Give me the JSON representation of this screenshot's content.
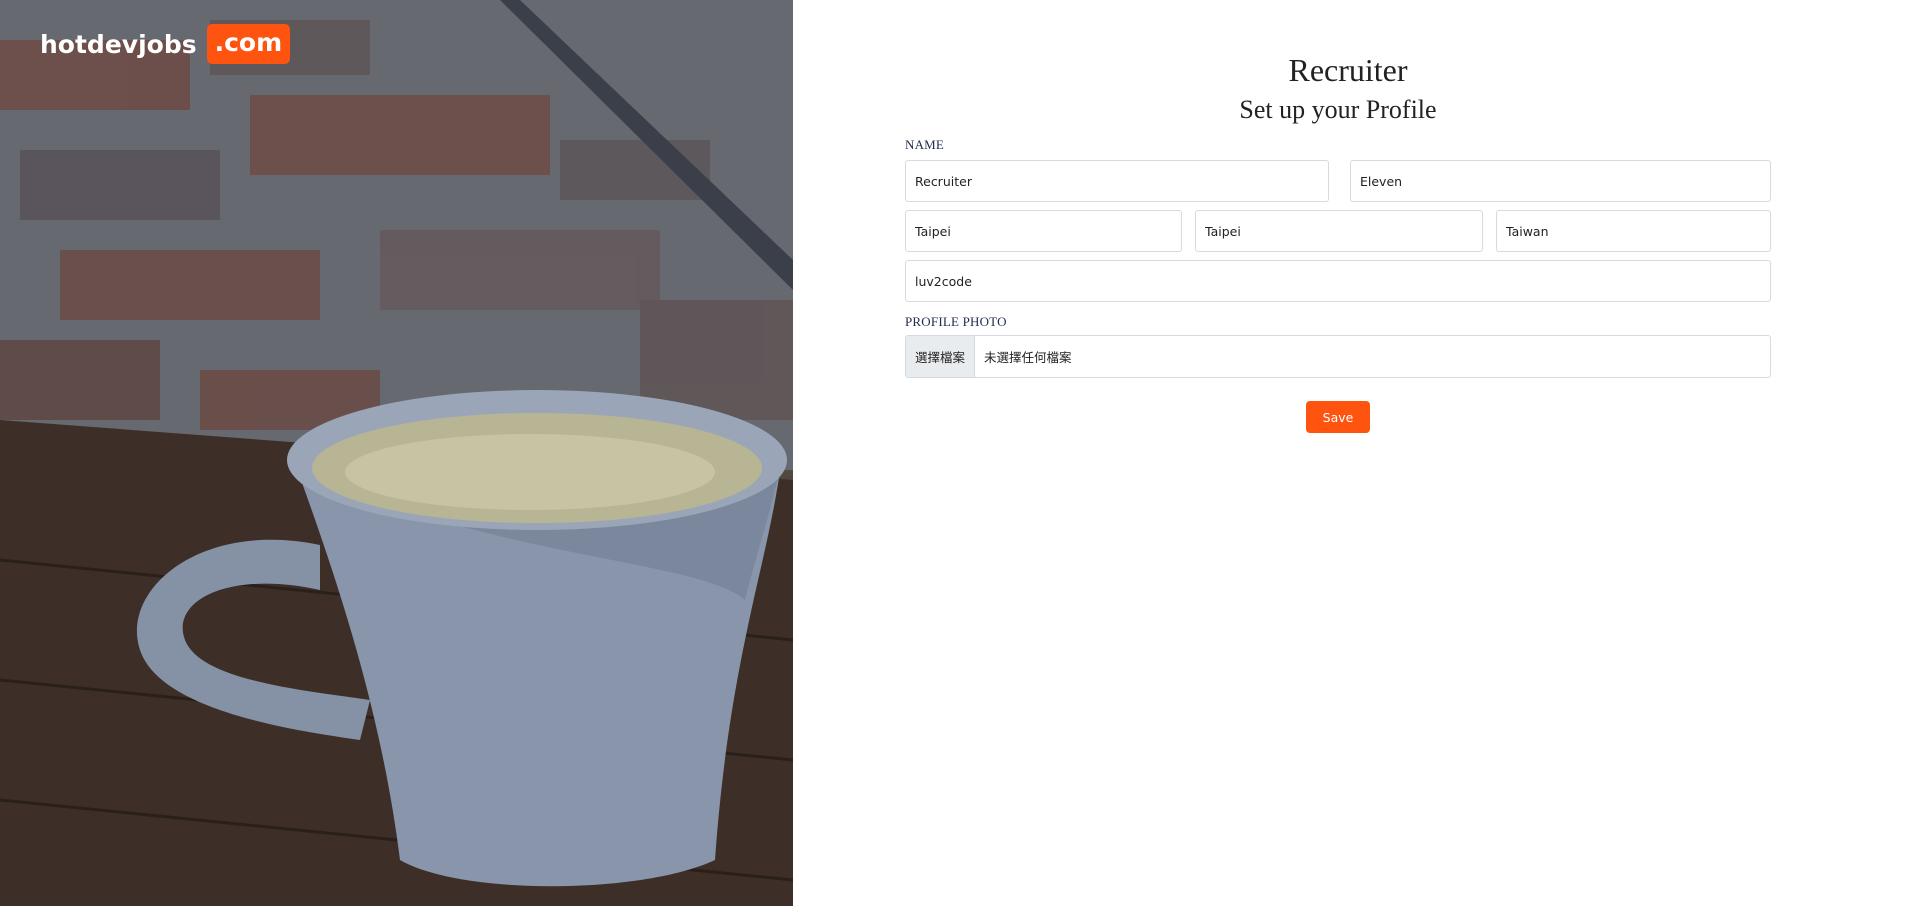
{
  "brand": {
    "name": "hotdevjobs",
    "suffix": ".com",
    "accent_color": "#ff5310"
  },
  "form": {
    "role_title": "Recruiter",
    "page_title": "Set up your Profile",
    "name_label": "NAME",
    "first_name": "Recruiter",
    "last_name": "Eleven",
    "city": "Taipei",
    "state": "Taipei",
    "country": "Taiwan",
    "company": "luv2code",
    "photo_label": "PROFILE PHOTO",
    "file_button_label": "選擇檔案",
    "file_status": "未選擇任何檔案",
    "save_label": "Save"
  }
}
